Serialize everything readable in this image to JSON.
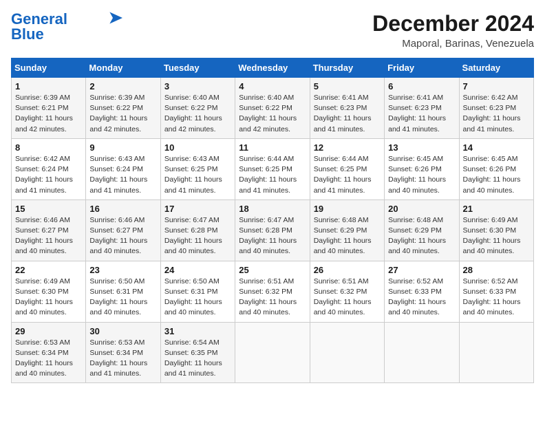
{
  "logo": {
    "line1": "General",
    "line2": "Blue"
  },
  "header": {
    "month_year": "December 2024",
    "location": "Maporal, Barinas, Venezuela"
  },
  "days_of_week": [
    "Sunday",
    "Monday",
    "Tuesday",
    "Wednesday",
    "Thursday",
    "Friday",
    "Saturday"
  ],
  "weeks": [
    [
      {
        "day": "1",
        "sunrise": "6:39 AM",
        "sunset": "6:21 PM",
        "daylight": "11 hours and 42 minutes."
      },
      {
        "day": "2",
        "sunrise": "6:39 AM",
        "sunset": "6:22 PM",
        "daylight": "11 hours and 42 minutes."
      },
      {
        "day": "3",
        "sunrise": "6:40 AM",
        "sunset": "6:22 PM",
        "daylight": "11 hours and 42 minutes."
      },
      {
        "day": "4",
        "sunrise": "6:40 AM",
        "sunset": "6:22 PM",
        "daylight": "11 hours and 42 minutes."
      },
      {
        "day": "5",
        "sunrise": "6:41 AM",
        "sunset": "6:23 PM",
        "daylight": "11 hours and 41 minutes."
      },
      {
        "day": "6",
        "sunrise": "6:41 AM",
        "sunset": "6:23 PM",
        "daylight": "11 hours and 41 minutes."
      },
      {
        "day": "7",
        "sunrise": "6:42 AM",
        "sunset": "6:23 PM",
        "daylight": "11 hours and 41 minutes."
      }
    ],
    [
      {
        "day": "8",
        "sunrise": "6:42 AM",
        "sunset": "6:24 PM",
        "daylight": "11 hours and 41 minutes."
      },
      {
        "day": "9",
        "sunrise": "6:43 AM",
        "sunset": "6:24 PM",
        "daylight": "11 hours and 41 minutes."
      },
      {
        "day": "10",
        "sunrise": "6:43 AM",
        "sunset": "6:25 PM",
        "daylight": "11 hours and 41 minutes."
      },
      {
        "day": "11",
        "sunrise": "6:44 AM",
        "sunset": "6:25 PM",
        "daylight": "11 hours and 41 minutes."
      },
      {
        "day": "12",
        "sunrise": "6:44 AM",
        "sunset": "6:25 PM",
        "daylight": "11 hours and 41 minutes."
      },
      {
        "day": "13",
        "sunrise": "6:45 AM",
        "sunset": "6:26 PM",
        "daylight": "11 hours and 40 minutes."
      },
      {
        "day": "14",
        "sunrise": "6:45 AM",
        "sunset": "6:26 PM",
        "daylight": "11 hours and 40 minutes."
      }
    ],
    [
      {
        "day": "15",
        "sunrise": "6:46 AM",
        "sunset": "6:27 PM",
        "daylight": "11 hours and 40 minutes."
      },
      {
        "day": "16",
        "sunrise": "6:46 AM",
        "sunset": "6:27 PM",
        "daylight": "11 hours and 40 minutes."
      },
      {
        "day": "17",
        "sunrise": "6:47 AM",
        "sunset": "6:28 PM",
        "daylight": "11 hours and 40 minutes."
      },
      {
        "day": "18",
        "sunrise": "6:47 AM",
        "sunset": "6:28 PM",
        "daylight": "11 hours and 40 minutes."
      },
      {
        "day": "19",
        "sunrise": "6:48 AM",
        "sunset": "6:29 PM",
        "daylight": "11 hours and 40 minutes."
      },
      {
        "day": "20",
        "sunrise": "6:48 AM",
        "sunset": "6:29 PM",
        "daylight": "11 hours and 40 minutes."
      },
      {
        "day": "21",
        "sunrise": "6:49 AM",
        "sunset": "6:30 PM",
        "daylight": "11 hours and 40 minutes."
      }
    ],
    [
      {
        "day": "22",
        "sunrise": "6:49 AM",
        "sunset": "6:30 PM",
        "daylight": "11 hours and 40 minutes."
      },
      {
        "day": "23",
        "sunrise": "6:50 AM",
        "sunset": "6:31 PM",
        "daylight": "11 hours and 40 minutes."
      },
      {
        "day": "24",
        "sunrise": "6:50 AM",
        "sunset": "6:31 PM",
        "daylight": "11 hours and 40 minutes."
      },
      {
        "day": "25",
        "sunrise": "6:51 AM",
        "sunset": "6:32 PM",
        "daylight": "11 hours and 40 minutes."
      },
      {
        "day": "26",
        "sunrise": "6:51 AM",
        "sunset": "6:32 PM",
        "daylight": "11 hours and 40 minutes."
      },
      {
        "day": "27",
        "sunrise": "6:52 AM",
        "sunset": "6:33 PM",
        "daylight": "11 hours and 40 minutes."
      },
      {
        "day": "28",
        "sunrise": "6:52 AM",
        "sunset": "6:33 PM",
        "daylight": "11 hours and 40 minutes."
      }
    ],
    [
      {
        "day": "29",
        "sunrise": "6:53 AM",
        "sunset": "6:34 PM",
        "daylight": "11 hours and 40 minutes."
      },
      {
        "day": "30",
        "sunrise": "6:53 AM",
        "sunset": "6:34 PM",
        "daylight": "11 hours and 41 minutes."
      },
      {
        "day": "31",
        "sunrise": "6:54 AM",
        "sunset": "6:35 PM",
        "daylight": "11 hours and 41 minutes."
      },
      null,
      null,
      null,
      null
    ]
  ]
}
